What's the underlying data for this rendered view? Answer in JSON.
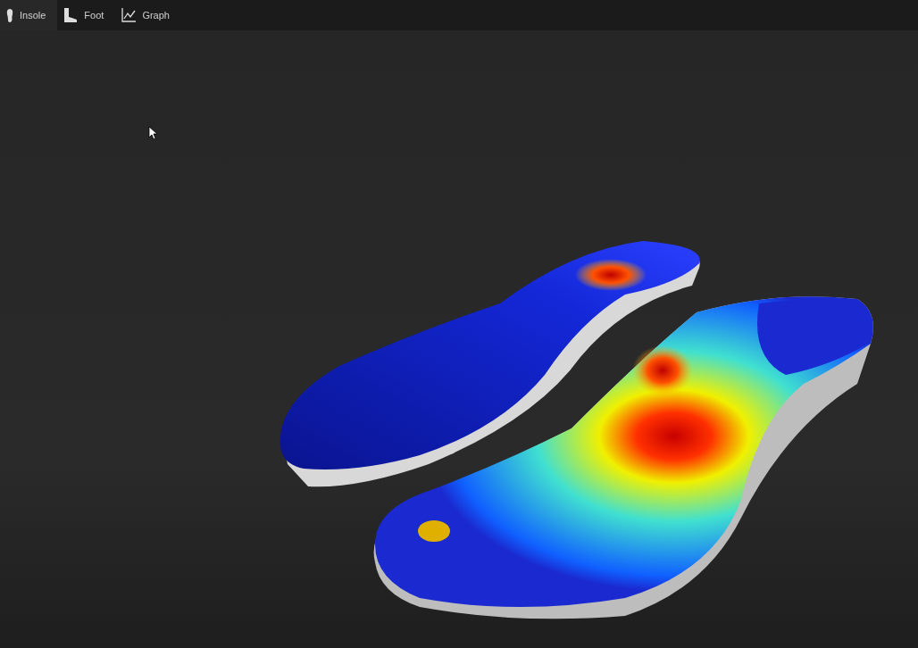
{
  "tabs": [
    {
      "label": "Insole",
      "kind": "insole",
      "selected": true
    },
    {
      "label": "Foot",
      "kind": "foot",
      "selected": false
    },
    {
      "label": "Graph",
      "kind": "graph",
      "selected": false
    }
  ]
}
